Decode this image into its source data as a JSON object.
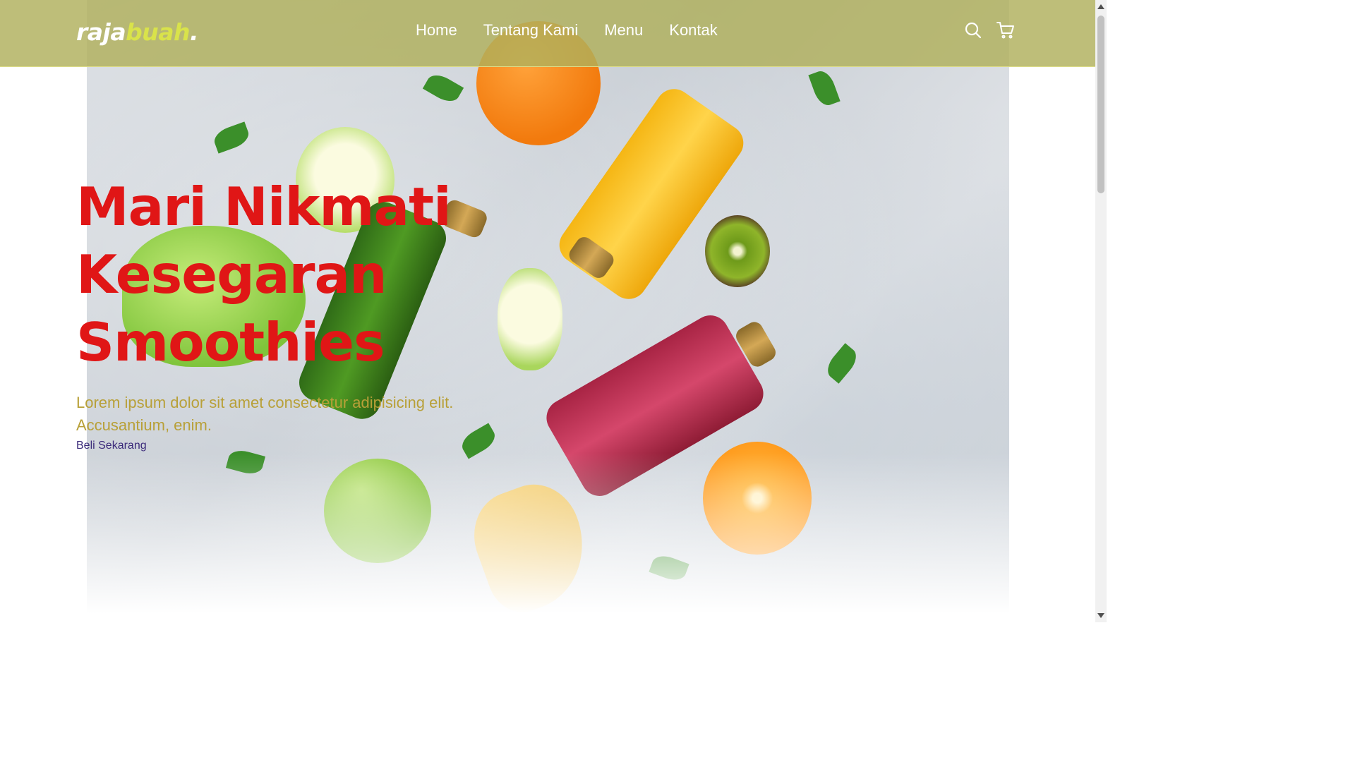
{
  "navbar": {
    "logo": {
      "part1": "raja",
      "part2": "buah",
      "part3": "."
    },
    "links": [
      "Home",
      "Tentang Kami",
      "Menu",
      "Kontak"
    ],
    "icons": [
      "search-icon",
      "cart-icon"
    ]
  },
  "hero": {
    "title_lines": [
      "Mari Nikmati",
      "Kesegaran",
      "Smoothies"
    ],
    "description": "Lorem ipsum dolor sit amet consectetur adipisicing elit. Accusantium, enim.",
    "cta_label": "Beli Sekarang"
  },
  "colors": {
    "navbar_bg": "#b0b05c",
    "title": "#e01616",
    "description": "#b8a038",
    "logo_accent": "#d9e34a",
    "cta": "#3b2a7a"
  }
}
